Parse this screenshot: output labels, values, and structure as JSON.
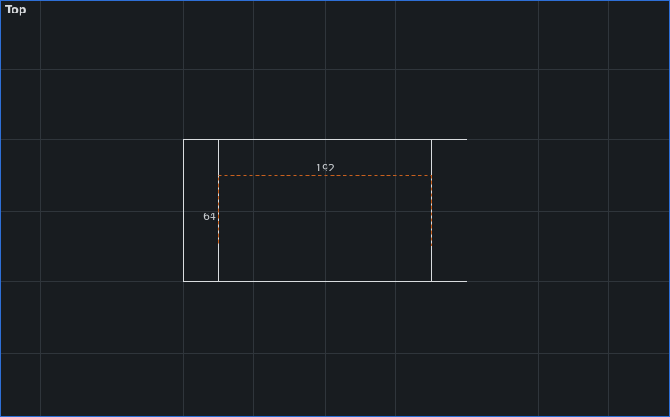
{
  "viewport": {
    "label": "Top",
    "border_color": "#2e6fd6",
    "background": "#181c20",
    "grid_color": "#2f353b"
  },
  "selection": {
    "width_label": "192",
    "height_label": "64",
    "outline_color": "#d9dcdf",
    "dash_color": "#c8601e"
  }
}
